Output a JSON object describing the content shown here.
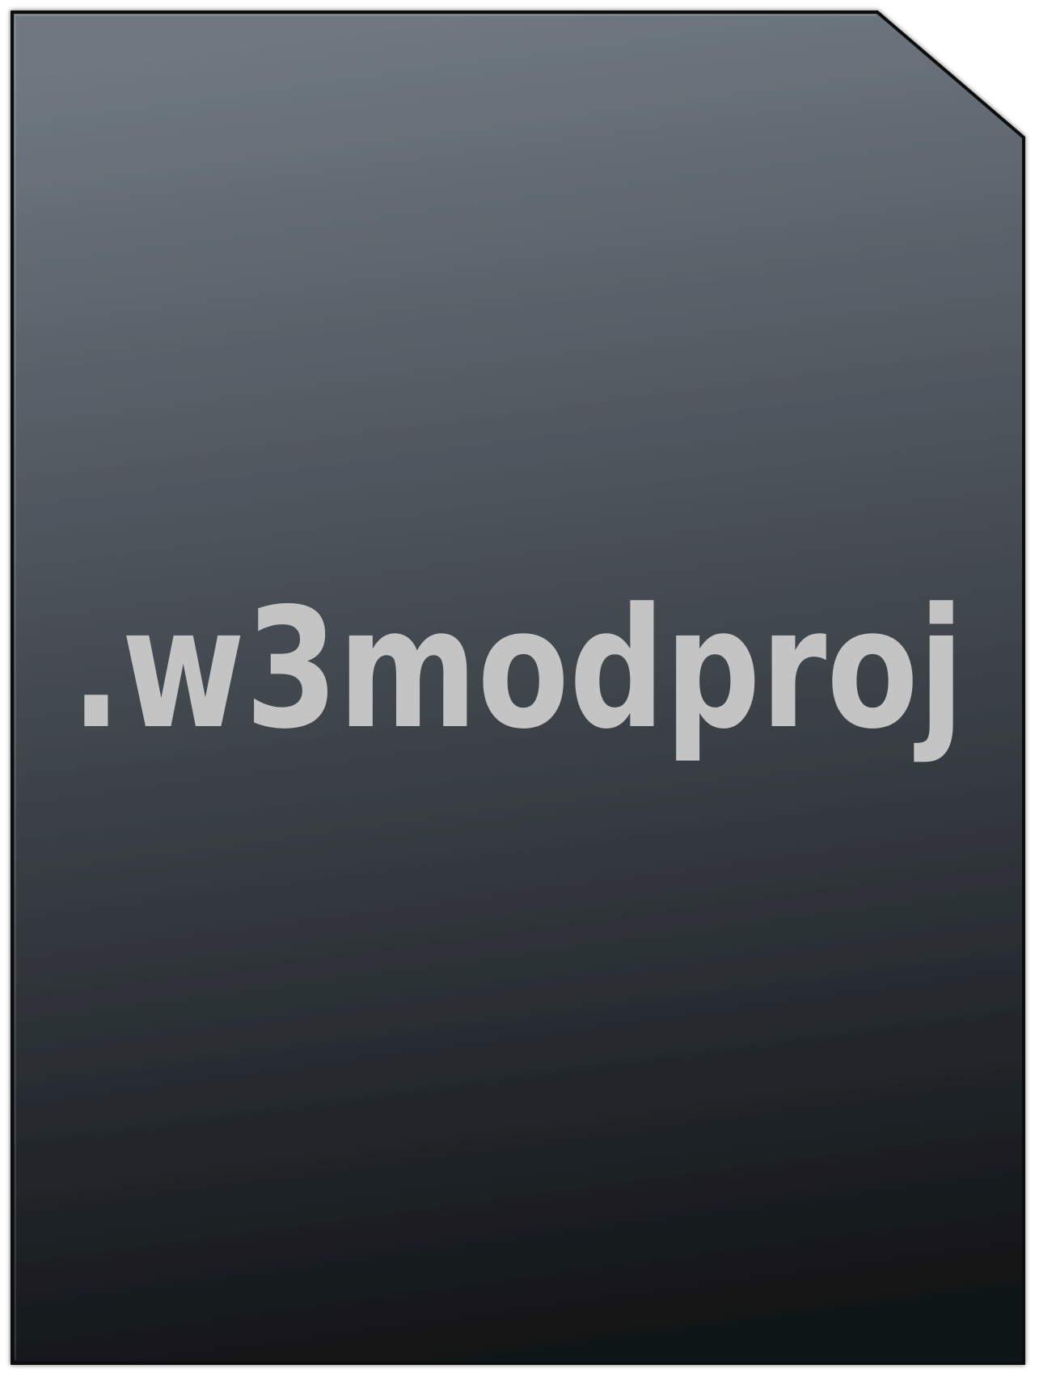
{
  "file_icon": {
    "extension_label": ".w3modproj",
    "colors": {
      "top": "#6e7780",
      "bottom": "#101316",
      "text": "#c4c4c4",
      "border": "#0c0e10"
    }
  }
}
